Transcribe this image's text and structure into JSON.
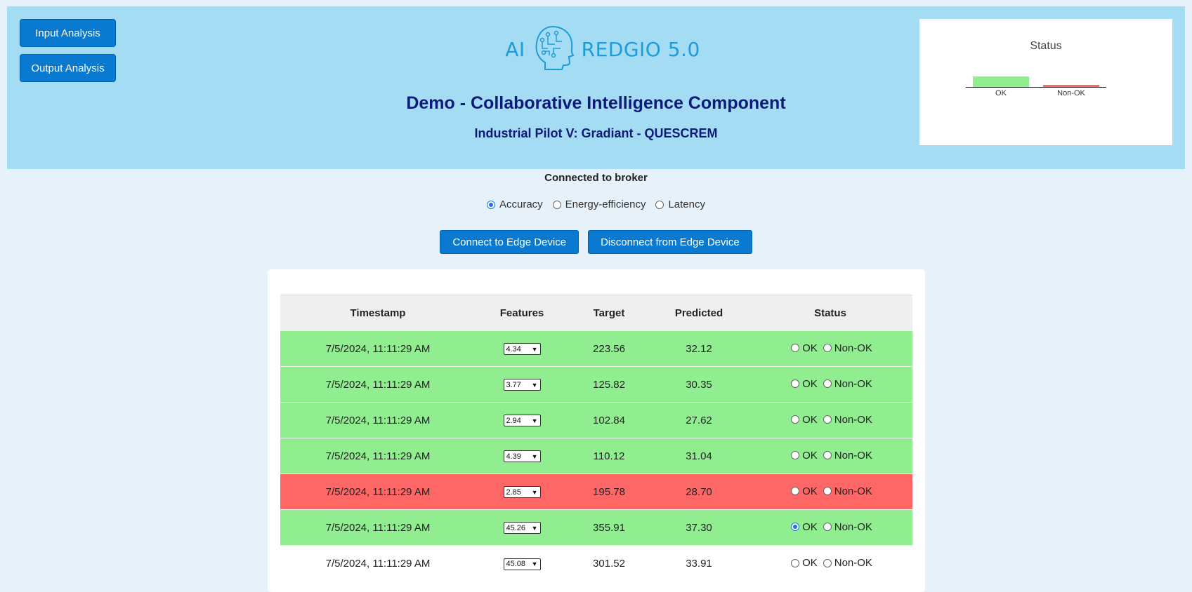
{
  "nav": {
    "input_analysis": "Input Analysis",
    "output_analysis": "Output Analysis"
  },
  "logo": {
    "left_text": "AI",
    "right_text": "REDGIO 5.0"
  },
  "header": {
    "title": "Demo - Collaborative Intelligence Component",
    "subtitle": "Industrial Pilot V: Gradiant - QUESCREM"
  },
  "status_chart": {
    "title": "Status",
    "chart_data": {
      "type": "bar",
      "categories": [
        "OK",
        "Non-OK"
      ],
      "values": [
        5,
        1
      ],
      "colors": [
        "#90ee90",
        "#ff6666"
      ]
    }
  },
  "connection": {
    "status": "Connected to broker"
  },
  "metric_options": [
    "Accuracy",
    "Energy-efficiency",
    "Latency"
  ],
  "metric_selected": "Accuracy",
  "actions": {
    "connect": "Connect to Edge Device",
    "disconnect": "Disconnect from Edge Device"
  },
  "table": {
    "headers": [
      "Timestamp",
      "Features",
      "Target",
      "Predicted",
      "Status"
    ],
    "status_labels": {
      "ok": "OK",
      "nok": "Non-OK"
    },
    "rows": [
      {
        "timestamp": "7/5/2024, 11:11:29 AM",
        "feature": "4.34",
        "target": "223.56",
        "predicted": "32.12",
        "row_state": "ok",
        "checked": ""
      },
      {
        "timestamp": "7/5/2024, 11:11:29 AM",
        "feature": "3.77",
        "target": "125.82",
        "predicted": "30.35",
        "row_state": "ok",
        "checked": ""
      },
      {
        "timestamp": "7/5/2024, 11:11:29 AM",
        "feature": "2.94",
        "target": "102.84",
        "predicted": "27.62",
        "row_state": "ok",
        "checked": ""
      },
      {
        "timestamp": "7/5/2024, 11:11:29 AM",
        "feature": "4.39",
        "target": "110.12",
        "predicted": "31.04",
        "row_state": "ok",
        "checked": ""
      },
      {
        "timestamp": "7/5/2024, 11:11:29 AM",
        "feature": "2.85",
        "target": "195.78",
        "predicted": "28.70",
        "row_state": "nok",
        "checked": ""
      },
      {
        "timestamp": "7/5/2024, 11:11:29 AM",
        "feature": "45.26",
        "target": "355.91",
        "predicted": "37.30",
        "row_state": "ok",
        "checked": "ok"
      },
      {
        "timestamp": "7/5/2024, 11:11:29 AM",
        "feature": "45.08",
        "target": "301.52",
        "predicted": "33.91",
        "row_state": "none",
        "checked": ""
      }
    ]
  }
}
